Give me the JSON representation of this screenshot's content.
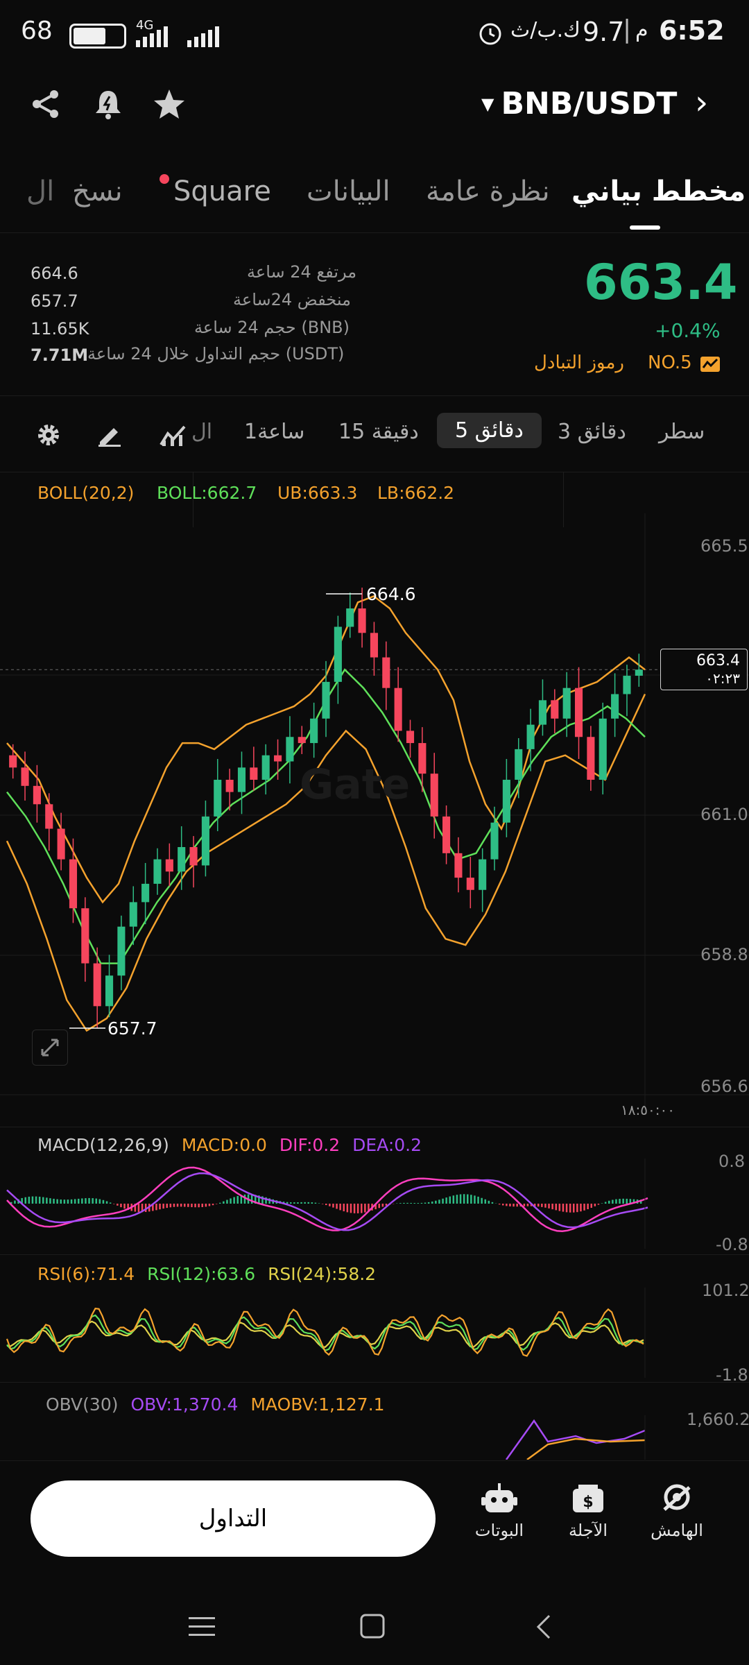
{
  "status_bar": {
    "time": "6:52",
    "meridiem": "م",
    "speed": "9.7",
    "speed_unit": "ك.ب/ث",
    "battery": "68",
    "network": "4G"
  },
  "header": {
    "pair": "BNB/USDT"
  },
  "tabs": [
    {
      "label": "مخطط بياني",
      "active": true
    },
    {
      "label": "نظرة عامة"
    },
    {
      "label": "البيانات"
    },
    {
      "label": "Square",
      "dot": true
    },
    {
      "label": "نسخ"
    },
    {
      "label": "ال"
    }
  ],
  "price": {
    "last": "663.4",
    "change": "+0.4%",
    "rank": "NO.5",
    "rank_label": "رموز التبادل",
    "stats": [
      {
        "label": "مرتفع 24 ساعة",
        "value": "664.6"
      },
      {
        "label": "منخفض 24ساعة",
        "value": "657.7"
      },
      {
        "label": "حجم 24 ساعة (BNB)",
        "value": "11.65K"
      },
      {
        "label": "حجم التداول خلال 24 ساعة (USDT)",
        "value": "7.71M"
      }
    ]
  },
  "intervals": [
    {
      "label": "سطر"
    },
    {
      "label": "3 دقائق"
    },
    {
      "label": "5 دقائق",
      "active": true
    },
    {
      "label": "15 دقيقة"
    },
    {
      "label": "1ساعة"
    },
    {
      "label": "ال"
    }
  ],
  "boll": {
    "name": "BOLL(20,2)",
    "mid": "BOLL:662.7",
    "ub": "UB:663.3",
    "lb": "LB:662.2"
  },
  "chart_data": {
    "type": "candlestick",
    "y_ticks": [
      "665.5",
      "661.0",
      "658.8",
      "656.6"
    ],
    "ylim": [
      656.6,
      665.5
    ],
    "high_marker": "664.6",
    "low_marker": "657.7",
    "last_price_tag": "663.4",
    "countdown": "٠٢:٢٣",
    "time_label": "١٨:٥٠:٠٠",
    "watermark": "Gate",
    "close": [
      661.8,
      661.5,
      661.2,
      660.8,
      660.3,
      659.5,
      658.6,
      657.9,
      658.4,
      659.2,
      659.6,
      659.9,
      660.3,
      660.1,
      660.5,
      660.2,
      661.0,
      661.6,
      661.4,
      661.8,
      661.6,
      662.0,
      661.9,
      662.3,
      662.2,
      662.6,
      663.2,
      664.1,
      664.4,
      664.0,
      663.6,
      663.1,
      662.4,
      662.2,
      661.7,
      661.0,
      660.4,
      660.0,
      659.8,
      660.3,
      660.9,
      661.6,
      662.1,
      662.5,
      662.9,
      662.6,
      663.1,
      662.3,
      661.6,
      662.6,
      663.0,
      663.3,
      663.4
    ],
    "boll_upper": [
      662.2,
      661.9,
      661.6,
      661.0,
      660.5,
      660.0,
      659.6,
      659.9,
      660.6,
      661.2,
      661.8,
      662.2,
      662.2,
      662.1,
      662.3,
      662.5,
      662.6,
      662.7,
      662.8,
      663.0,
      663.3,
      663.9,
      664.5,
      664.6,
      664.4,
      664.0,
      663.7,
      663.4,
      662.9,
      661.9,
      661.2,
      660.8,
      661.4,
      662.3,
      662.8,
      663.0,
      663.1,
      663.2,
      663.4,
      663.6,
      663.4
    ],
    "boll_mid": [
      661.4,
      661.0,
      660.5,
      659.9,
      659.2,
      658.6,
      658.6,
      659.1,
      659.6,
      660.0,
      660.5,
      660.9,
      661.2,
      661.4,
      661.6,
      661.9,
      662.3,
      662.9,
      663.4,
      663.1,
      662.7,
      662.2,
      661.6,
      660.8,
      660.3,
      660.4,
      660.9,
      661.4,
      661.9,
      662.3,
      662.5,
      662.6,
      662.8,
      662.6,
      662.3
    ],
    "boll_lower": [
      660.6,
      659.9,
      659.0,
      658.0,
      657.5,
      657.7,
      658.2,
      659.0,
      659.6,
      660.1,
      660.4,
      660.6,
      660.8,
      661.0,
      661.2,
      661.5,
      662.0,
      662.4,
      662.1,
      661.4,
      660.5,
      659.5,
      659.0,
      658.9,
      659.4,
      660.1,
      661.0,
      661.9,
      662.0,
      661.8,
      661.6,
      662.3,
      663.0
    ]
  },
  "macd": {
    "name": "MACD(12,26,9)",
    "macd": "MACD:0.0",
    "dif": "DIF:0.2",
    "dea": "DEA:0.2",
    "axis_top": "0.8",
    "axis_bottom": "-0.8"
  },
  "rsi": {
    "rsi6": "RSI(6):71.4",
    "rsi12": "RSI(12):63.6",
    "rsi24": "RSI(24):58.2",
    "axis_top": "101.2",
    "axis_bottom": "-1.8"
  },
  "obv": {
    "name": "OBV(30)",
    "obv": "OBV:1,370.4",
    "maobv": "MAOBV:1,127.1",
    "axis_top": "1,660.2"
  },
  "bottom_nav": {
    "trade": "التداول",
    "items": [
      {
        "label": "الهامش",
        "icon": "margin-icon"
      },
      {
        "label": "الآجلة",
        "icon": "futures-icon"
      },
      {
        "label": "البوتات",
        "icon": "bot-icon"
      }
    ]
  },
  "colors": {
    "up": "#2ebd85",
    "down": "#f6465d",
    "boll_band": "#f4a22d",
    "boll_mid": "#5fe05a",
    "dif": "#ff3fbf",
    "dea": "#a64bf4",
    "rank": "#f4a22d"
  }
}
